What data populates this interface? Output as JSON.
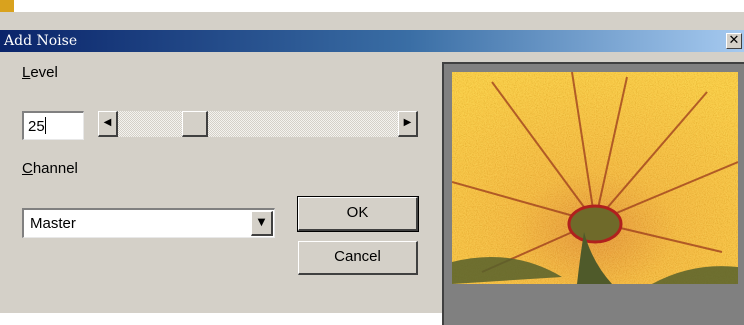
{
  "window": {
    "title": "Add Noise",
    "close_glyph": "✕"
  },
  "level": {
    "label_access": "L",
    "label_rest": "evel",
    "value": "25",
    "slider_value": 25,
    "slider_min": 0,
    "slider_max": 100
  },
  "channel": {
    "label_access": "C",
    "label_rest": "hannel",
    "selected": "Master"
  },
  "buttons": {
    "ok": "OK",
    "cancel": "Cancel"
  },
  "icons": {
    "scroll_left": "◀",
    "scroll_right": "▶",
    "dropdown": "▼"
  },
  "colors": {
    "title_start": "#0a246a",
    "title_end": "#a6caf0",
    "dialog_bg": "#d4d0c8",
    "preview_bg": "#808080"
  }
}
